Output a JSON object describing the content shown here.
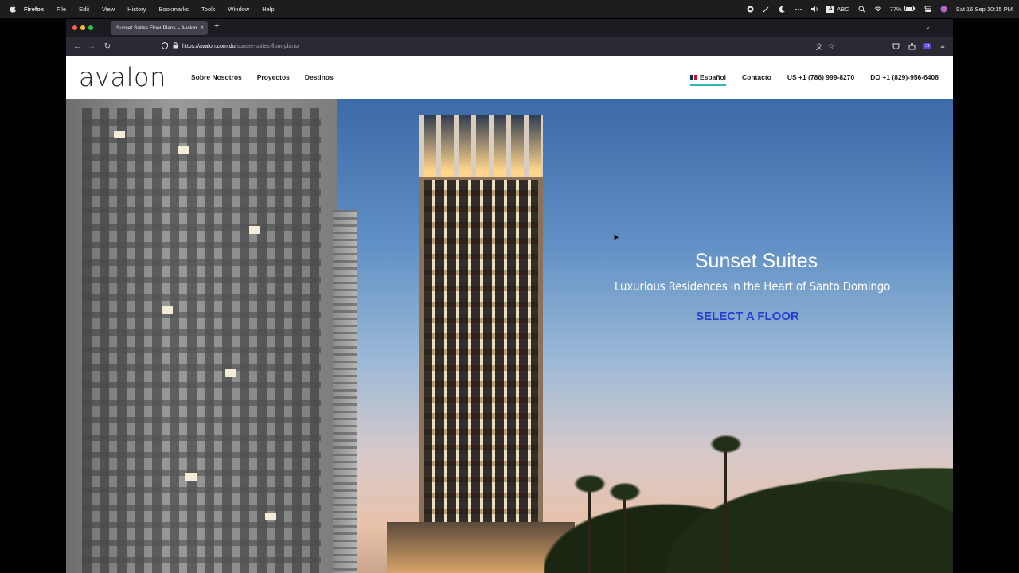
{
  "menubar": {
    "app_name": "Firefox",
    "menus": [
      "File",
      "Edit",
      "View",
      "History",
      "Bookmarks",
      "Tools",
      "Window",
      "Help"
    ],
    "input_badge": "ABC",
    "battery": "77%",
    "datetime": "Sat 16 Sep  10:15 PM"
  },
  "browser": {
    "tab_title": "Sunset Suites Floor Plans – Avalon",
    "url_domain": "https://avalon.com.do",
    "url_path": "/sunset-suites-floor-plans/",
    "extension_badge": "31"
  },
  "site": {
    "logo": "avalon",
    "nav_left": [
      "Sobre Nosotros",
      "Proyectos",
      "Destinos"
    ],
    "lang": "Español",
    "contact": "Contacto",
    "phone_us": "US +1 (786) 999-8270",
    "phone_do": "DO +1 (829)-956-6408"
  },
  "hero": {
    "title": "Sunset Suites",
    "subtitle": "Luxurious Residences in the Heart of Santo Domingo",
    "cta": "SELECT A FLOOR"
  },
  "colors": {
    "cta": "#2a3bd0",
    "lang_underline": "#2fb7b7"
  }
}
